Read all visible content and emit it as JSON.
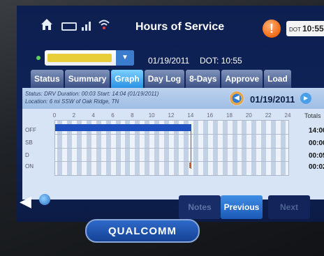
{
  "header": {
    "title": "Hours of Service",
    "alert_symbol": "!",
    "clock_prefix": "DOT",
    "clock_time": "10:55",
    "icons": [
      "home-icon",
      "keyboard-icon",
      "signal-icon",
      "wifi-icon",
      "alert-icon"
    ]
  },
  "driver_row": {
    "date": "01/19/2011",
    "dot_time": "DOT: 10:55"
  },
  "tabs": [
    {
      "label": "Status",
      "active": false
    },
    {
      "label": "Summary",
      "active": false
    },
    {
      "label": "Graph",
      "active": true
    },
    {
      "label": "Day Log",
      "active": false
    },
    {
      "label": "8-Days",
      "active": false
    },
    {
      "label": "Approve",
      "active": false
    },
    {
      "label": "Load",
      "active": false
    }
  ],
  "graph_panel": {
    "status_line": "Status: DRV   Duration: 00:03   Start: 14:04 (01/19/2011)",
    "location_line": "Location: 6 mi SSW of Oak Ridge, TN",
    "date": "01/19/2011",
    "hours": [
      "0",
      "2",
      "4",
      "6",
      "8",
      "10",
      "12",
      "14",
      "16",
      "18",
      "20",
      "22",
      "24"
    ],
    "totals_label": "Totals",
    "rows": [
      {
        "label": "OFF",
        "total": "14:00"
      },
      {
        "label": "SB",
        "total": "00:00"
      },
      {
        "label": "D",
        "total": "00:05"
      },
      {
        "label": "ON",
        "total": "00:02"
      }
    ],
    "duty_off_until_hour": 14
  },
  "bottom": {
    "notes_label": "Notes",
    "previous_label": "Previous",
    "next_label": "Next"
  },
  "brand": "QUALCOMM",
  "colors": {
    "accent": "#2b91e3",
    "alert": "#f06a12",
    "duty_bar": "#1e4fbf"
  }
}
